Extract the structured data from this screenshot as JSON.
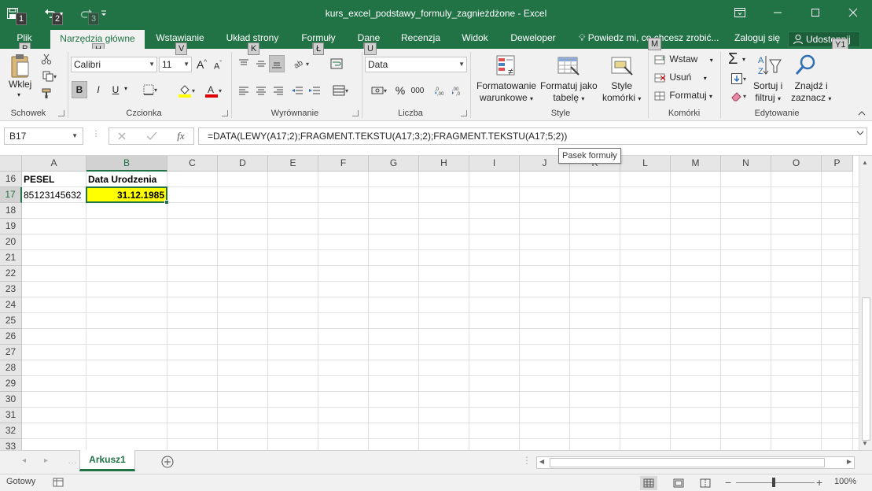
{
  "window": {
    "title": "kurs_excel_podstawy_formuly_zagnieżdżone - Excel",
    "qat_keytips": [
      "1",
      "2",
      "3"
    ]
  },
  "tabs": [
    {
      "label": "Plik",
      "keytip": "P"
    },
    {
      "label": "Narzędzia główne",
      "keytip": "H"
    },
    {
      "label": "Wstawianie",
      "keytip": "V"
    },
    {
      "label": "Układ strony",
      "keytip": "K"
    },
    {
      "label": "Formuły",
      "keytip": "Ł"
    },
    {
      "label": "Dane",
      "keytip": "U"
    },
    {
      "label": "Recenzja",
      "keytip": ""
    },
    {
      "label": "Widok",
      "keytip": ""
    },
    {
      "label": "Deweloper",
      "keytip": ""
    }
  ],
  "tell_me": "Powiedz mi, co chcesz zrobić...",
  "login": "Zaloguj się",
  "share": "Udostępnij",
  "share_keytip": "Y1",
  "ribbon": {
    "clipboard": {
      "paste": "Wklej",
      "label": "Schowek"
    },
    "font": {
      "name": "Calibri",
      "size": "11",
      "label": "Czcionka",
      "bold": "B",
      "italic": "I",
      "underline": "U",
      "grow": "A",
      "shrink": "A"
    },
    "alignment": {
      "label": "Wyrównanie"
    },
    "number": {
      "format": "Data",
      "label": "Liczba",
      "percent": "%",
      "thousands": "000"
    },
    "styles": {
      "conditional": [
        "Formatowanie",
        "warunkowe"
      ],
      "table": [
        "Formatuj jako",
        "tabelę"
      ],
      "cell": [
        "Style",
        "komórki"
      ],
      "label": "Style"
    },
    "cells": {
      "insert": "Wstaw",
      "delete": "Usuń",
      "format": "Formatuj",
      "label": "Komórki",
      "keytip": "M"
    },
    "editing": {
      "sort": [
        "Sortuj i",
        "filtruj"
      ],
      "find": [
        "Znajdź i",
        "zaznacz"
      ],
      "label": "Edytowanie",
      "sigma": "Σ"
    }
  },
  "formula_bar": {
    "name_box": "B17",
    "formula": "=DATA(LEWY(A17;2);FRAGMENT.TEKSTU(A17;3;2);FRAGMENT.TEKSTU(A17;5;2))",
    "tooltip": "Pasek formuły",
    "fx": "fx"
  },
  "columns": [
    "A",
    "B",
    "C",
    "D",
    "E",
    "F",
    "G",
    "H",
    "I",
    "J",
    "K",
    "L",
    "M",
    "N",
    "O",
    "P"
  ],
  "rows": [
    "16",
    "17",
    "18",
    "19",
    "20",
    "21",
    "22",
    "23",
    "24",
    "25",
    "26",
    "27",
    "28",
    "29",
    "30",
    "31",
    "32",
    "33"
  ],
  "cells": {
    "A16": "PESEL",
    "B16": "Data Urodzenia",
    "A17": "85123145632",
    "B17": "31.12.1985"
  },
  "colors": {
    "accent": "#217346",
    "highlight": "#ffff00"
  },
  "sheets": [
    {
      "name": "Arkusz1"
    }
  ],
  "status": {
    "ready": "Gotowy",
    "zoom": "100%"
  }
}
